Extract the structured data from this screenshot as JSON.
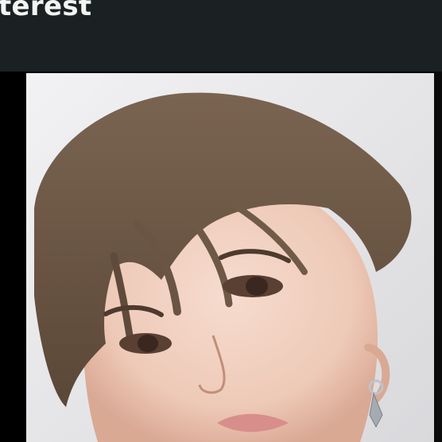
{
  "header": {
    "title": "terest"
  },
  "photo": {
    "icon": "portrait-photo"
  },
  "colors": {
    "header_bg": "#1b2123",
    "title_text": "#f3f5f5",
    "page_bg": "#000000"
  }
}
